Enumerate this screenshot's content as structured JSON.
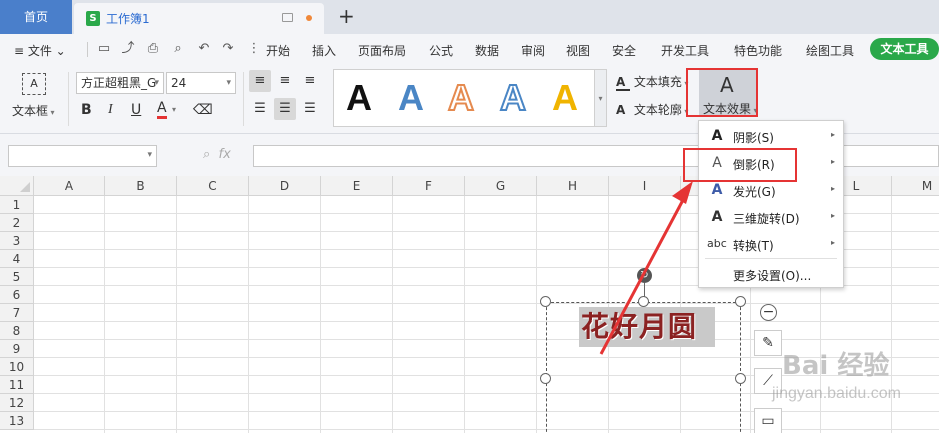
{
  "tabs": {
    "home": "首页",
    "doc": "工作簿1",
    "doc_icon": "S",
    "new_tab": "+"
  },
  "menubar": {
    "file": "≡ 文件 ⌄",
    "items": [
      "开始",
      "插入",
      "页面布局",
      "公式",
      "数据",
      "审阅",
      "视图",
      "安全",
      "开发工具",
      "特色功能",
      "绘图工具"
    ],
    "active": "文本工具"
  },
  "toolbar": {
    "textbox_label": "文本框",
    "font_name": "方正超粗黑_G",
    "font_size": "24",
    "bold": "B",
    "italic": "I",
    "underline": "U",
    "font_color_letter": "A",
    "text_fill": "文本填充",
    "text_outline": "文本轮廓",
    "text_effect": "文本效果",
    "gallery_letter": "A",
    "gallery_colors": [
      "#111111",
      "#4a86c5",
      "#e58a4f",
      "#4a86c5",
      "#f0b400"
    ]
  },
  "formula": {
    "fx": "fx"
  },
  "grid": {
    "columns": [
      "A",
      "B",
      "C",
      "D",
      "E",
      "F",
      "G",
      "H",
      "I",
      "J",
      "K",
      "L",
      "M"
    ],
    "rows": [
      "1",
      "2",
      "3",
      "4",
      "5",
      "6",
      "7",
      "8",
      "9",
      "10",
      "11",
      "12",
      "13"
    ]
  },
  "textbox": {
    "content": "花好月圆"
  },
  "dropdown": {
    "items": [
      {
        "label": "阴影(S)",
        "icon": "A"
      },
      {
        "label": "倒影(R)",
        "icon": "A"
      },
      {
        "label": "发光(G)",
        "icon": "A"
      },
      {
        "label": "三维旋转(D)",
        "icon": "A"
      },
      {
        "label": "转换(T)",
        "icon": "abc"
      }
    ],
    "more": "更多设置(O)..."
  },
  "watermark": {
    "logo": "Bai 经验",
    "url": "jingyan.baidu.com"
  },
  "colors": {
    "accent_green": "#2aa84a",
    "home_tab": "#4a7fcb",
    "highlight_red": "#e53434",
    "wordart_text": "#8b2222"
  }
}
